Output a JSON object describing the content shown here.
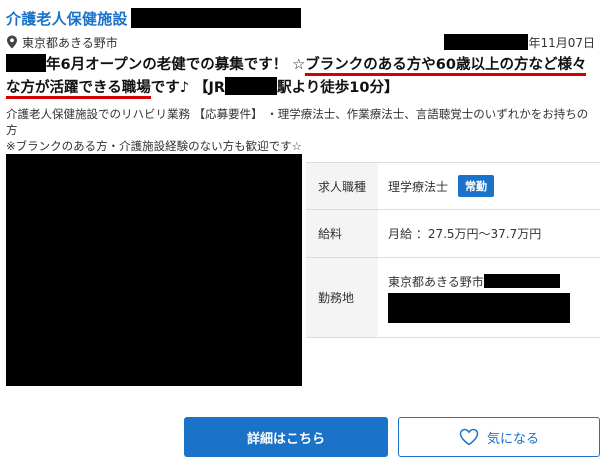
{
  "job": {
    "title": "介護老人保健施設",
    "location": "東京都あきる野市",
    "date_suffix": "年11月07日",
    "headline_part1": "年6月オープンの老健での募集です！ ☆",
    "headline_underlined_1": "ブランクのある方や60歳以上の方など様々",
    "headline_underlined_2": "な方が活躍できる職場",
    "headline_part2": "です♪ 【JR",
    "headline_part3": "駅より徒歩10分】",
    "description_line1": "介護老人保健施設でのリハビリ業務 【応募要件】 ・理学療法士、作業療法士、言語聴覚士のいずれかをお持ちの方",
    "description_line2": "※ブランクのある方・介護施設経験のない方も歓迎です☆"
  },
  "details": {
    "occupation_label": "求人職種",
    "occupation_value": "理学療法士",
    "employment_badge": "常勤",
    "salary_label": "給料",
    "salary_value": "月給 ：27.5万円〜37.7万円",
    "workplace_label": "勤務地",
    "workplace_value": "東京都あきる野市"
  },
  "actions": {
    "detail_button": "詳細はこちら",
    "favorite_button": "気になる"
  },
  "colors": {
    "brand_blue": "#1a73c8",
    "underline_red": "#d60000",
    "redaction": "#000000"
  },
  "icons": {
    "location": "pin-icon",
    "favorite": "heart-icon"
  }
}
